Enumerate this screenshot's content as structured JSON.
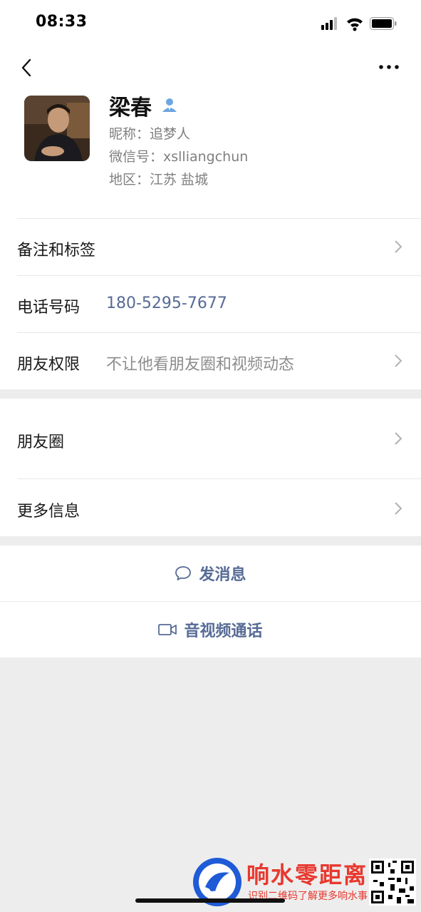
{
  "status_bar": {
    "time": "08:33"
  },
  "profile": {
    "name": "梁春",
    "nickname": "昵称：追梦人",
    "wechat_id": "微信号：xslliangchun",
    "region": "地区：江苏  盐城"
  },
  "rows": {
    "remarks_label": "备注和标签",
    "phone_label": "电话号码",
    "phone_value": "180-5295-7677",
    "permission_label": "朋友权限",
    "permission_value": "不让他看朋友圈和视频动态",
    "moments_label": "朋友圈",
    "more_info_label": "更多信息"
  },
  "actions": {
    "message_label": "发消息",
    "call_label": "音视频通话"
  },
  "watermark": {
    "title": "响水零距离",
    "subtitle": "识别二维码了解更多响水事"
  },
  "colors": {
    "link": "#576b95",
    "background": "#ededed"
  }
}
